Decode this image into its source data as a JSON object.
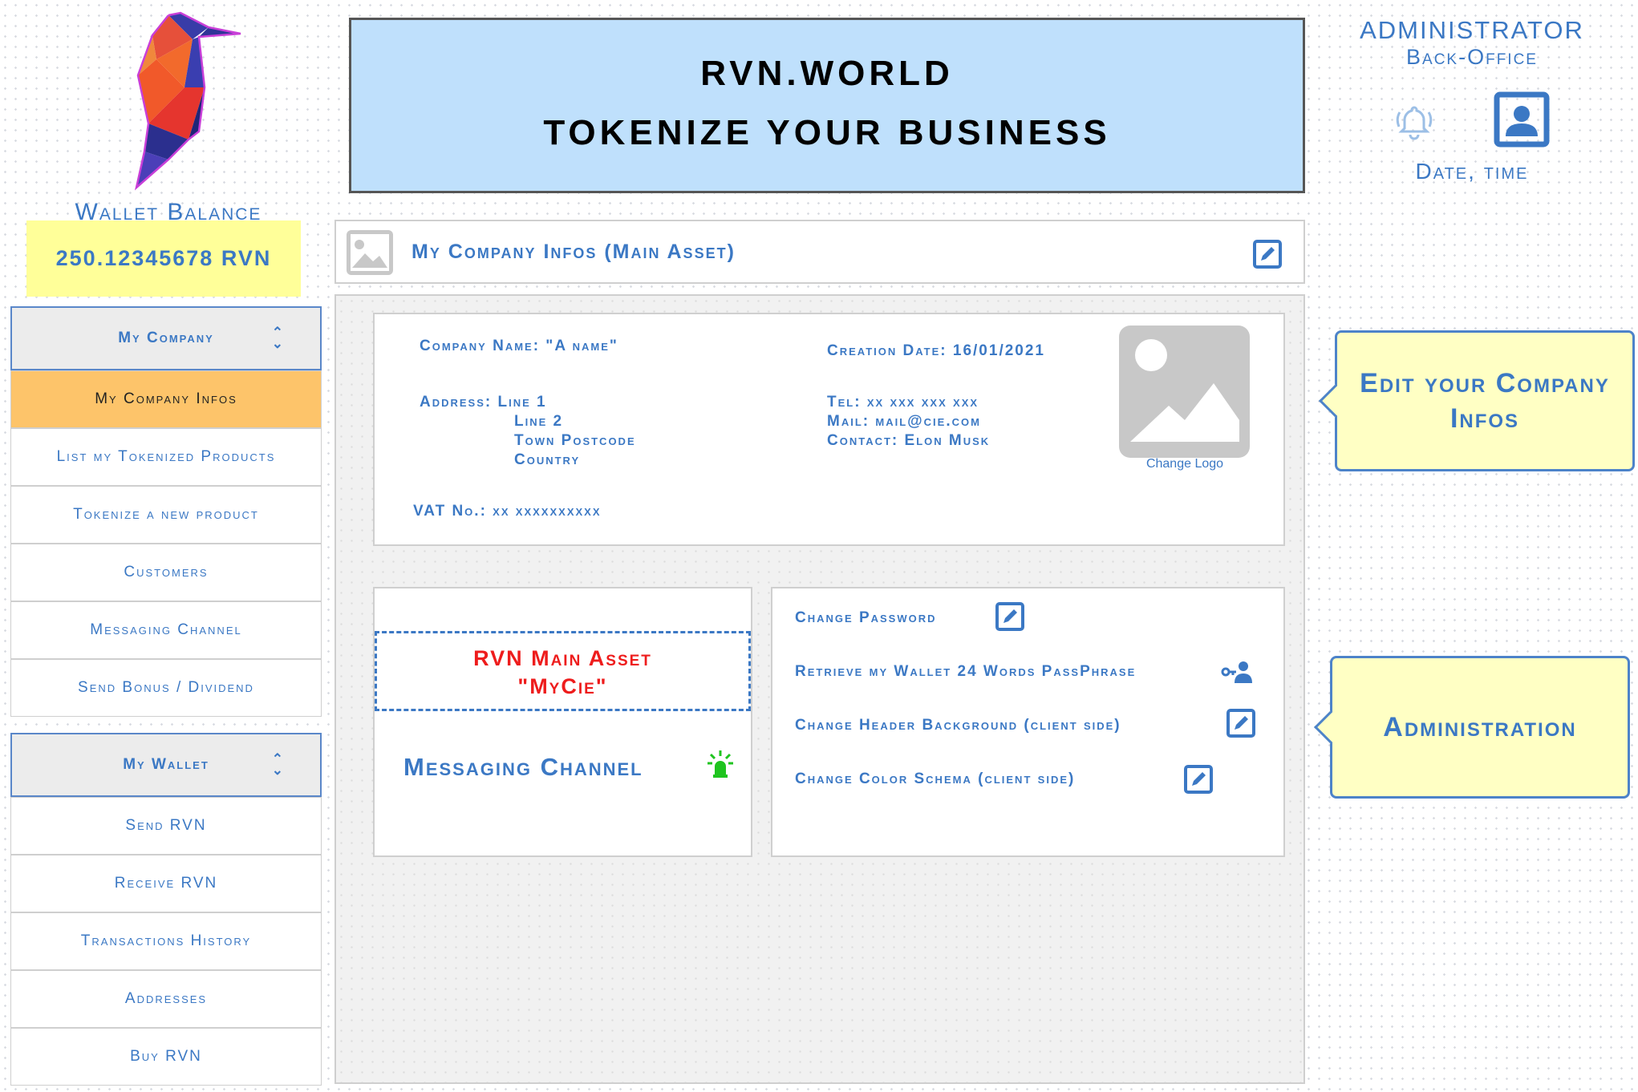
{
  "header": {
    "line1": "RVN.WORLD",
    "line2": "TOKENIZE YOUR BUSINESS"
  },
  "admin": {
    "title": "ADMINISTRATOR",
    "subtitle": "Back-Office",
    "datetime": "Date, time",
    "icons": [
      "bell-icon",
      "user-profile-icon"
    ]
  },
  "wallet": {
    "label": "Wallet Balance",
    "balance": "250.12345678 RVN"
  },
  "sidebar": {
    "company": {
      "header": "My Company",
      "items": [
        {
          "label": "My Company Infos",
          "active": true
        },
        {
          "label": "List my Tokenized Products"
        },
        {
          "label": "Tokenize a new product"
        },
        {
          "label": "Customers"
        },
        {
          "label": "Messaging Channel"
        },
        {
          "label": "Send Bonus / Dividend"
        }
      ]
    },
    "wallet": {
      "header": "My Wallet",
      "items": [
        {
          "label": "Send RVN"
        },
        {
          "label": "Receive RVN"
        },
        {
          "label": "Transactions History"
        },
        {
          "label": "Addresses"
        },
        {
          "label": "Buy RVN"
        }
      ]
    }
  },
  "infos_bar": {
    "title": "My Company Infos (Main Asset)"
  },
  "company": {
    "name": "Company Name: \"A name\"",
    "address_label": "Address: Line 1",
    "address_line2": "Line 2",
    "address_line3": "Town Postcode",
    "address_line4": "Country",
    "vat": "VAT No.: xx xxxxxxxxxx",
    "creation_date": "Creation Date: 16/01/2021",
    "tel": "Tel: xx xxx xxx xxx",
    "mail": "Mail: mail@cie.com",
    "contact": "Contact: Elon Musk",
    "change_logo": "Change Logo"
  },
  "messaging": {
    "asset_line1": "RVN Main Asset",
    "asset_line2": "\"MyCie\"",
    "channel": "Messaging Channel"
  },
  "administration": {
    "items": [
      "Change Password",
      "Retrieve my Wallet 24 Words PassPhrase",
      "Change Header Background (client side)",
      "Change Color Schema (client side)"
    ]
  },
  "callouts": {
    "edit": "Edit your Company Infos",
    "admin": "Administration"
  },
  "colors": {
    "accent": "#3b78c4",
    "active_menu": "#fdc46a",
    "wallet_bg": "#ffff99",
    "banner_bg": "#bfe0fc",
    "asset_red": "#ee1c1c",
    "callout_bg": "#ffffc4",
    "bulb_green": "#1fc41f"
  }
}
